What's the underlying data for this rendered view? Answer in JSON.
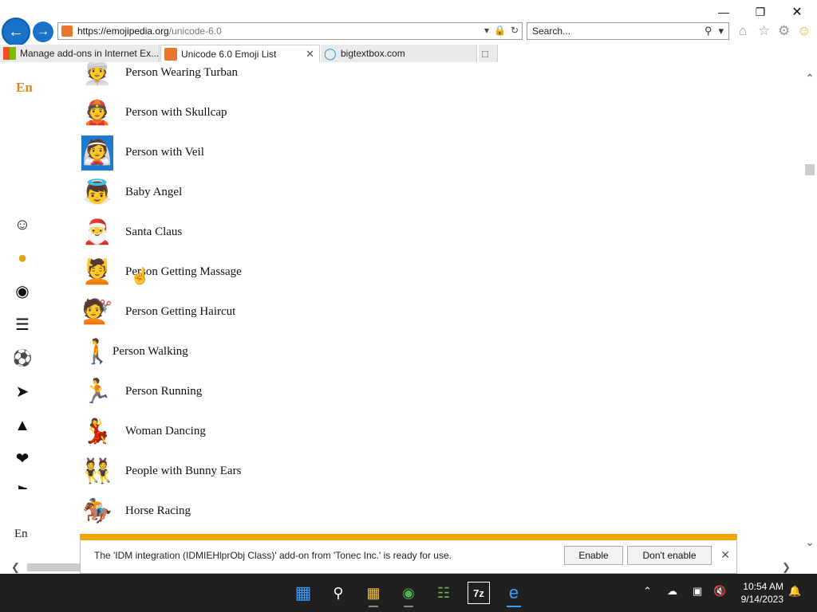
{
  "browser": {
    "address": {
      "host": "https://emojipedia.org",
      "path": "/unicode-6.0"
    },
    "search_placeholder": "Search...",
    "tabs": [
      {
        "label": "Manage add-ons in Internet Ex..."
      },
      {
        "label": "Unicode 6.0 Emoji List"
      },
      {
        "label": "bigtextbox.com"
      }
    ]
  },
  "page": {
    "logo_text": "En",
    "language_label": "En",
    "emoji_list": [
      {
        "name": "Person Wearing Turban",
        "glyph": "👳"
      },
      {
        "name": "Person with Skullcap",
        "glyph": "👲"
      },
      {
        "name": "Person with Veil",
        "glyph": "👰"
      },
      {
        "name": "Baby Angel",
        "glyph": "👼"
      },
      {
        "name": "Santa Claus",
        "glyph": "🎅"
      },
      {
        "name": "Person Getting Massage",
        "glyph": "💆"
      },
      {
        "name": "Person Getting Haircut",
        "glyph": "💇"
      },
      {
        "name": "Person Walking",
        "glyph": "🚶"
      },
      {
        "name": "Person Running",
        "glyph": "🏃"
      },
      {
        "name": "Woman Dancing",
        "glyph": "💃"
      },
      {
        "name": "People with Bunny Ears",
        "glyph": "👯"
      },
      {
        "name": "Horse Racing",
        "glyph": "🏇"
      }
    ],
    "sidebar_icons": [
      "smiley-icon",
      "person-icon",
      "bear-icon",
      "burger-icon",
      "soccer-ball-icon",
      "rocket-icon",
      "lightbulb-icon",
      "hearts-icon",
      "flags-icon"
    ]
  },
  "notification": {
    "message": "The 'IDM integration (IDMIEHlprObj Class)' add-on from 'Tonec Inc.' is ready for use.",
    "enable_label": "Enable",
    "dont_enable_label": "Don't enable"
  },
  "taskbar": {
    "time": "10:54 AM",
    "date": "9/14/2023"
  },
  "colors": {
    "accent_blue": "#1a73c8",
    "notification_bar": "#f0a800",
    "logo_orange": "#d88a1b"
  }
}
